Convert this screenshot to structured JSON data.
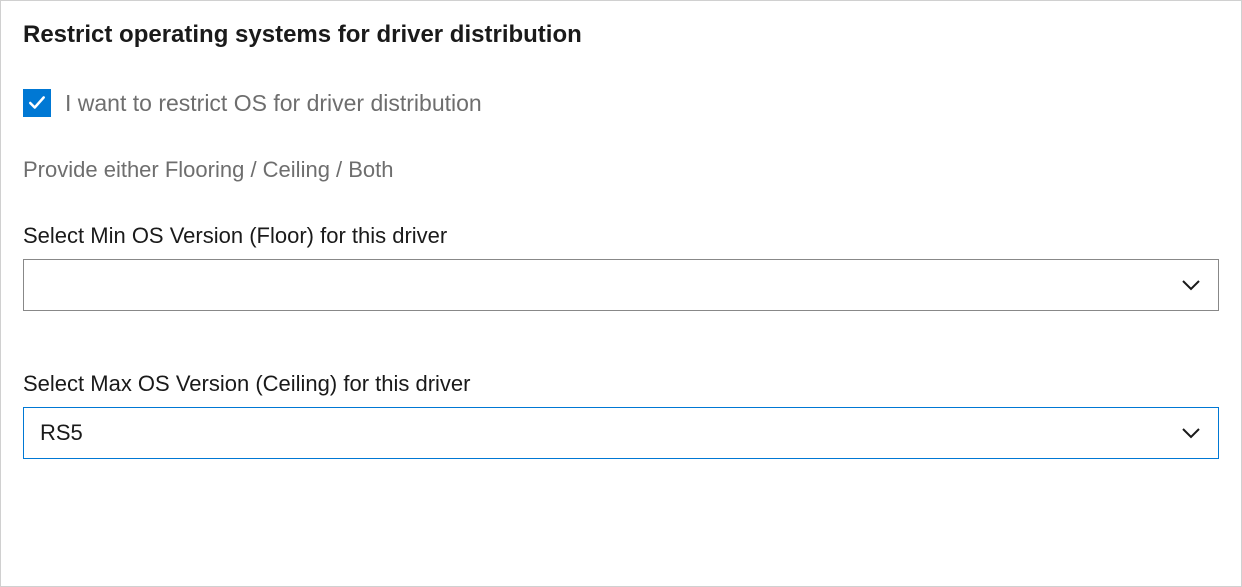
{
  "section": {
    "title": "Restrict operating systems for driver distribution"
  },
  "checkbox": {
    "label": "I want to restrict OS for driver distribution",
    "checked": true
  },
  "helper": {
    "text": "Provide either Flooring / Ceiling / Both"
  },
  "fields": {
    "min_os": {
      "label": "Select Min OS Version (Floor) for this driver",
      "value": ""
    },
    "max_os": {
      "label": "Select Max OS Version (Ceiling) for this driver",
      "value": "RS5"
    }
  }
}
